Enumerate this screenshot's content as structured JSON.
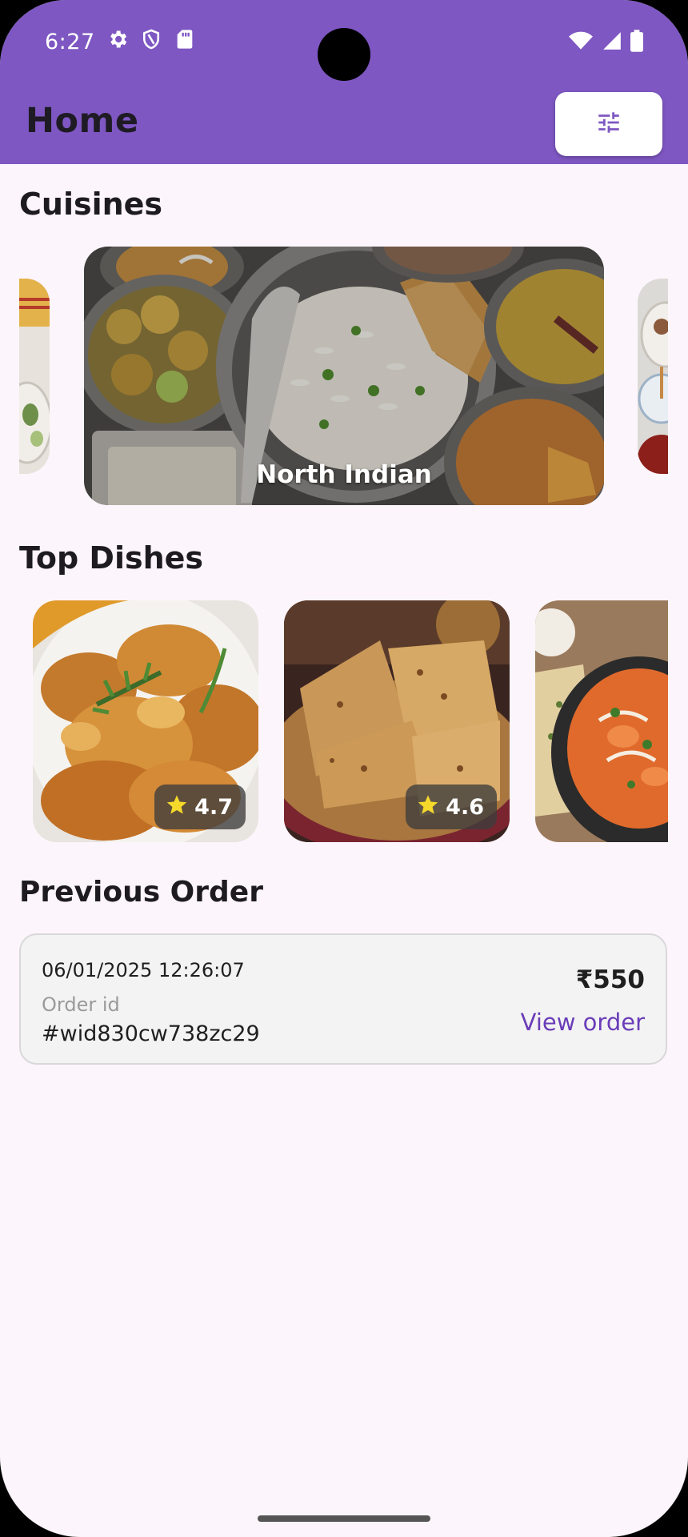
{
  "status_bar": {
    "time": "6:27",
    "left_icons": [
      "gear-icon",
      "shield-icon",
      "sd-card-icon"
    ],
    "right_icons": [
      "wifi-icon",
      "signal-icon",
      "battery-icon"
    ]
  },
  "app_bar": {
    "title": "Home",
    "filter_button_icon": "tune-sliders-icon",
    "background_color": "#7e57c2"
  },
  "cuisines": {
    "title": "Cuisines",
    "featured_label": "North Indian"
  },
  "top_dishes": {
    "title": "Top Dishes",
    "items": [
      {
        "rating": "4.7"
      },
      {
        "rating": "4.6"
      },
      {
        "rating": ""
      }
    ]
  },
  "previous_order": {
    "title": "Previous Order",
    "datetime": "06/01/2025 12:26:07",
    "order_id_label": "Order id",
    "order_id": "#wid830cw738zc29",
    "price": "₹550",
    "view_label": "View order",
    "accent_color": "#6a3db8"
  }
}
